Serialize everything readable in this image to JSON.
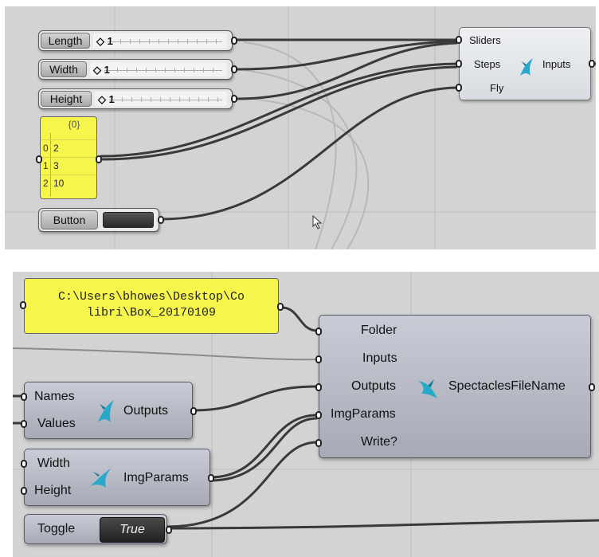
{
  "top_panel": {
    "sliders": [
      {
        "label": "Length",
        "value": "1"
      },
      {
        "label": "Width",
        "value": "1"
      },
      {
        "label": "Height",
        "value": "1"
      }
    ],
    "list_panel": {
      "header": "{0}",
      "rows": [
        {
          "index": "0",
          "value": "2"
        },
        {
          "index": "1",
          "value": "3"
        },
        {
          "index": "2",
          "value": "10"
        }
      ]
    },
    "button": {
      "label": "Button"
    },
    "inputs_component": {
      "inputs": [
        "Sliders",
        "Steps",
        "Fly"
      ],
      "output": "Inputs",
      "icon": "hummingbird-icon"
    }
  },
  "bottom_panel": {
    "path_panel": {
      "text_line1": "C:\\Users\\bhowes\\Desktop\\Co",
      "text_line2": "libri\\Box_20170109"
    },
    "outputs_component": {
      "inputs": [
        "Names",
        "Values"
      ],
      "output": "Outputs",
      "icon": "hummingbird-icon"
    },
    "imgparams_component": {
      "inputs": [
        "Width",
        "Height"
      ],
      "output": "ImgParams",
      "icon": "hummingbird-icon"
    },
    "toggle": {
      "label": "Toggle",
      "value": "True"
    },
    "spectacles_component": {
      "inputs": [
        "Folder",
        "Inputs",
        "Outputs",
        "ImgParams",
        "Write?"
      ],
      "output": "SpectaclesFileName",
      "icon": "hummingbird-icon"
    }
  },
  "colors": {
    "canvas": "#d3d3d3",
    "panel_yellow": "#f6f54c",
    "wire": "#3a3a3a"
  }
}
